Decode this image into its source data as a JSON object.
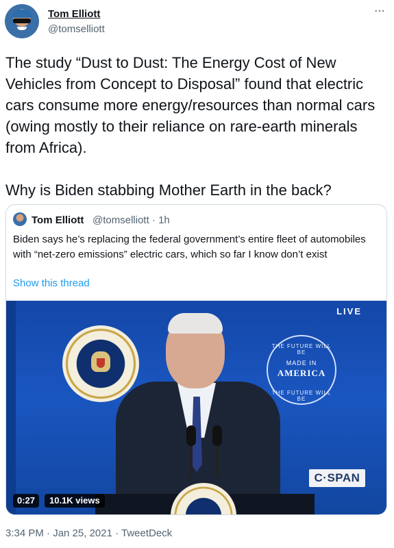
{
  "author": {
    "name": "Tom Elliott",
    "handle": "@tomselliott"
  },
  "more_icon": "⋯",
  "tweet": {
    "paragraphs": [
      "The study “Dust to Dust: The Energy Cost of New Vehicles from Concept to Disposal” found that electric cars consume more energy/resources than normal cars (owing mostly to their reliance on rare-earth minerals from Africa).",
      "Why is Biden stabbing Mother Earth in the back?"
    ]
  },
  "quote": {
    "name": "Tom Elliott",
    "handle_time": "@tomselliott · 1h",
    "text": "Biden says he’s replacing the federal government’s entire fleet of automobiles with “net-zero emissions” electric cars, which so far I know don’t exist",
    "show_thread": "Show this thread"
  },
  "video": {
    "live_label": "LIVE",
    "badge_top": "THE FUTURE WILL BE",
    "badge_made": "MADE IN",
    "badge_america": "AMERICA",
    "badge_bottom": "THE FUTURE WILL BE",
    "network": "C·SPAN",
    "duration": "0:27",
    "views": "10.1K views"
  },
  "timestamp": "3:34 PM · Jan 25, 2021 · TweetDeck",
  "colors": {
    "link": "#1d9bf0",
    "secondary_text": "#536471",
    "border": "#cfd9de"
  }
}
